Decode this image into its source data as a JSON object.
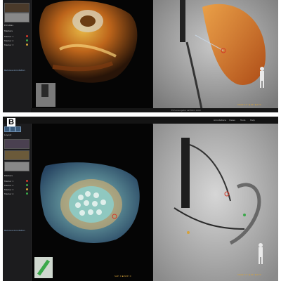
{
  "panel_a": {
    "letter": "",
    "volume_stat": "SAP: 0 ▪ SDP: 0",
    "fluoro_readout": "CRAN 21° ▪ 45° ▪ 170",
    "status_text": "Echonavigator ▪ EK20 1000",
    "sidebar_header": "EchoNav",
    "sidebar_section": "Markers",
    "markers": [
      {
        "label": "Marker 1",
        "color": "#d23a2a"
      },
      {
        "label": "Marker 2",
        "color": "#3aa84a"
      },
      {
        "label": "Marker 3",
        "color": "#d6a23a"
      }
    ],
    "footer_link": "Remove Annotation"
  },
  "panel_b": {
    "letter": "B",
    "menu_items": [
      "Annotations",
      "Views",
      "Tools",
      "Help"
    ],
    "right_label": "X-Ray",
    "volume_stat": "SAP: 0 ▪ SDP: 0",
    "fluoro_readout": "CRAN 21° ▪ 45° ▪ 170",
    "sidebar_header": "Layout",
    "sidebar_section": "Markers",
    "markers": [
      {
        "label": "Marker 1",
        "color": "#d23a2a"
      },
      {
        "label": "Marker 2",
        "color": "#3aa84a"
      },
      {
        "label": "Marker 3",
        "color": "#d6a23a"
      },
      {
        "label": "Marker 4",
        "color": "#3aa84a"
      }
    ],
    "footer_link": "Remove Annotation"
  }
}
